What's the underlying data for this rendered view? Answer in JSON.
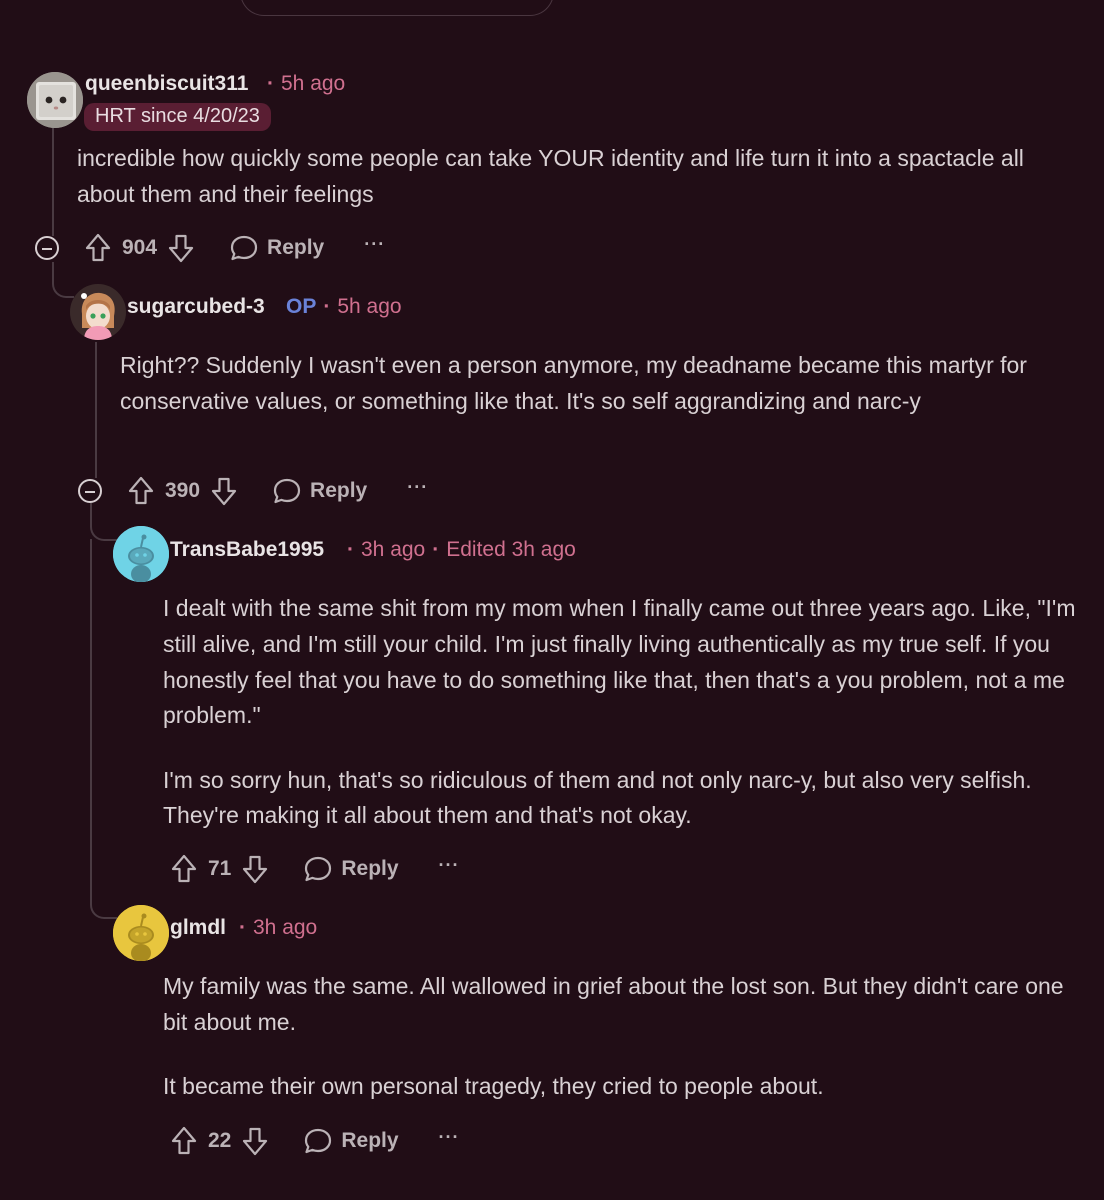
{
  "comments": [
    {
      "username": "queenbiscuit311",
      "time": "5h ago",
      "flair": "HRT since 4/20/23",
      "paragraphs": [
        "incredible how quickly some people can take YOUR identity and life turn it into a spactacle all about them and their feelings"
      ],
      "votes": "904",
      "reply_label": "Reply",
      "more_label": "···"
    },
    {
      "username": "sugarcubed-3",
      "op_label": "OP",
      "time": "5h ago",
      "paragraphs": [
        "Right?? Suddenly I wasn't even a person anymore, my deadname became this martyr for conservative values, or something like that. It's so self aggrandizing and narc-y"
      ],
      "votes": "390",
      "reply_label": "Reply",
      "more_label": "···"
    },
    {
      "username": "TransBabe1995",
      "time": "3h ago",
      "edited": "Edited 3h ago",
      "paragraphs": [
        "I dealt with the same shit from my mom when I finally came out three years ago. Like, \"I'm still alive, and I'm still your child. I'm just finally living authentically as my true self. If you honestly feel that you have to do something like that, then that's a you problem, not a me problem.\"",
        "I'm so sorry hun, that's so ridiculous of them and not only narc-y, but also very selfish. They're making it all about them and that's not okay."
      ],
      "votes": "71",
      "reply_label": "Reply",
      "more_label": "···"
    },
    {
      "username": "glmdl",
      "time": "3h ago",
      "paragraphs": [
        "My family was the same. All wallowed in grief about the lost son. But they didn't care one bit about me.",
        "It became their own personal tragedy, they cried to people about."
      ],
      "votes": "22",
      "reply_label": "Reply",
      "more_label": "···"
    }
  ],
  "colors": {
    "background": "#210d16",
    "meta_pink": "#d0708f",
    "op_blue": "#6a82d8",
    "flair_bg": "#5a1e33",
    "thread_line": "#4a3a42"
  }
}
